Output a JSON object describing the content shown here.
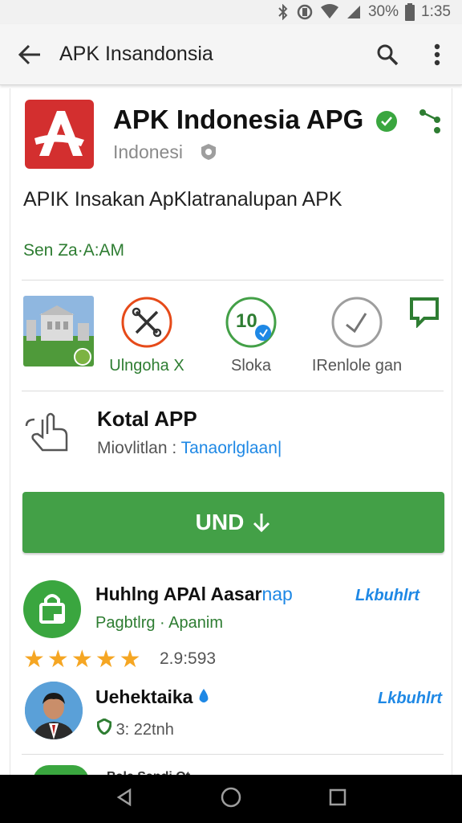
{
  "status_bar": {
    "battery_text": "30%",
    "time": "1:35"
  },
  "app_bar": {
    "title": "APK Insandonsia"
  },
  "app": {
    "name": "APK Indonesia APG",
    "developer": "Indonesi",
    "description": "APIK Insakan ApKlatranalupan APK",
    "update_line": "Sen Za·A:AM",
    "logo_letter": "A",
    "brand_color": "#d32f2f"
  },
  "features": [
    {
      "label": "",
      "icon": "screenshot-thumbnail"
    },
    {
      "label": "Ulngoha X",
      "icon": "tools-icon"
    },
    {
      "label": "Sloka",
      "icon": "downloads-badge-icon",
      "badge_text": "10"
    },
    {
      "label": "IRenlole gan",
      "icon": "check-badge-icon"
    },
    {
      "label": "",
      "icon": "chat-icon"
    }
  ],
  "rating_section": {
    "title": "Kotal APP",
    "sub_prefix": "Miovlitlan : ",
    "sub_link": "Tanaorlglaan|"
  },
  "install_button": {
    "label": "UND"
  },
  "reviews": [
    {
      "name": "Huhlng APAl Aasar",
      "tag": "nap",
      "subtitle": "Pagbtlrg · Apanim",
      "link": "Lkbuhlrt",
      "stars": 5,
      "count": "2.9:593"
    },
    {
      "name": "Uehektaika",
      "link": "Lkbuhlrt",
      "meta": "3: 22tnh"
    }
  ],
  "peek_text": "Bale Sandi Ot",
  "colors": {
    "accent_green": "#43a047",
    "link_blue": "#1e88e5",
    "star": "#f5a623"
  }
}
